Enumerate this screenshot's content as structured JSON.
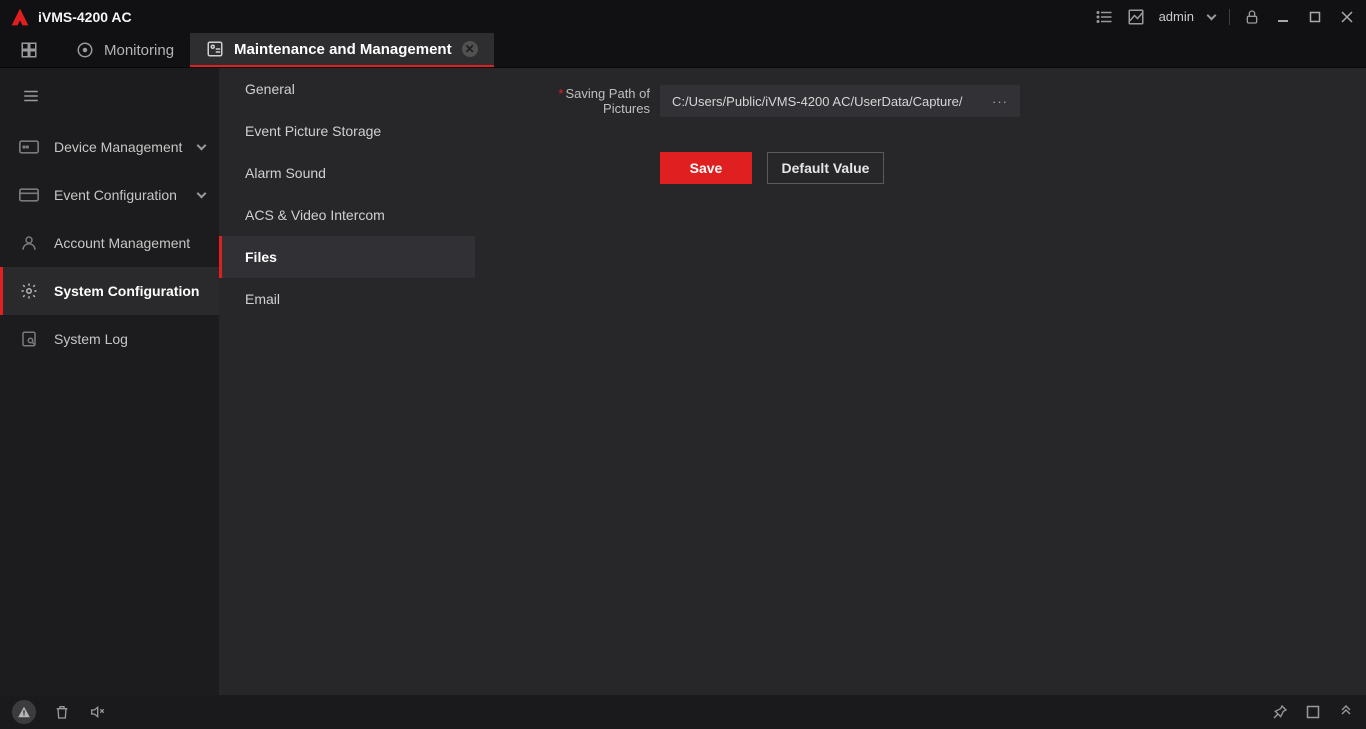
{
  "app": {
    "title": "iVMS-4200 AC"
  },
  "header": {
    "user": "admin"
  },
  "tabs": [
    {
      "label": "Monitoring"
    },
    {
      "label": "Maintenance and Management"
    }
  ],
  "sidebar": {
    "items": [
      {
        "label": "Device Management"
      },
      {
        "label": "Event Configuration"
      },
      {
        "label": "Account Management"
      },
      {
        "label": "System Configuration"
      },
      {
        "label": "System Log"
      }
    ]
  },
  "subnav": {
    "items": [
      {
        "label": "General"
      },
      {
        "label": "Event Picture Storage"
      },
      {
        "label": "Alarm Sound"
      },
      {
        "label": "ACS & Video Intercom"
      },
      {
        "label": "Files"
      },
      {
        "label": "Email"
      }
    ]
  },
  "form": {
    "saving_path_label": "Saving Path of Pictures",
    "saving_path_value": "C:/Users/Public/iVMS-4200 AC/UserData/Capture/",
    "browse_label": "···"
  },
  "buttons": {
    "save": "Save",
    "default": "Default Value"
  }
}
